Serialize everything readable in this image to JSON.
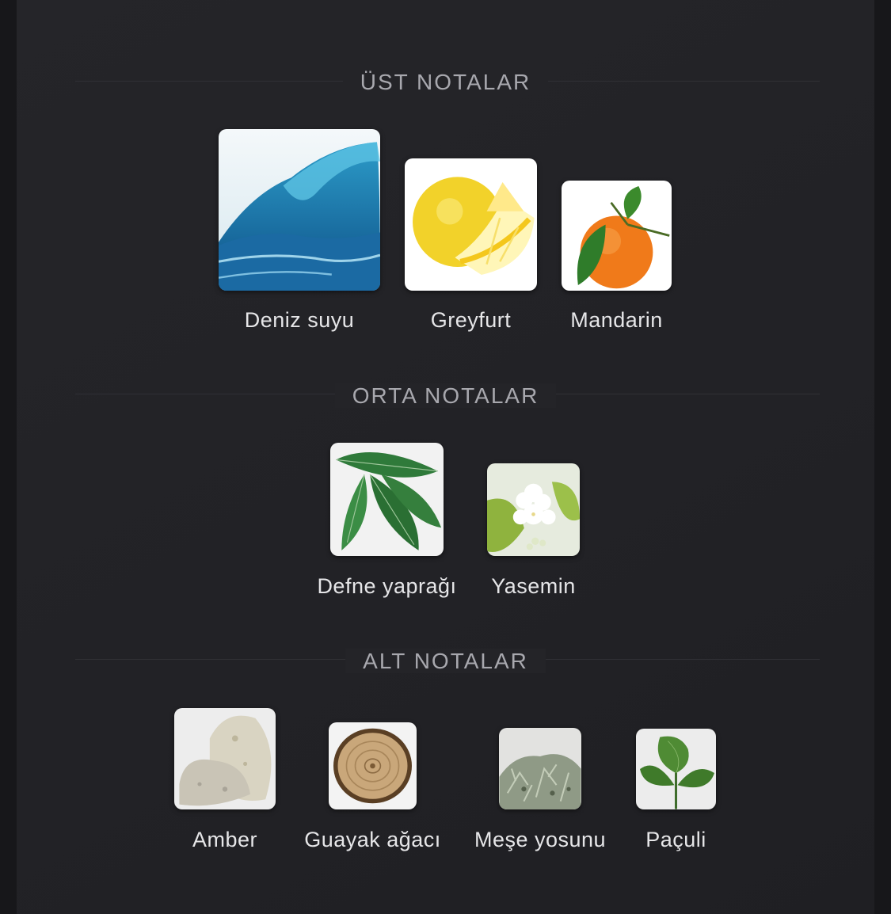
{
  "sections": [
    {
      "title": "ÜST NOTALAR",
      "notes": [
        {
          "label": "Deniz suyu",
          "icon": "sea-wave-icon"
        },
        {
          "label": "Greyfurt",
          "icon": "grapefruit-icon"
        },
        {
          "label": "Mandarin",
          "icon": "mandarin-icon"
        }
      ]
    },
    {
      "title": "ORTA NOTALAR",
      "notes": [
        {
          "label": "Defne yaprağı",
          "icon": "bay-leaf-icon"
        },
        {
          "label": "Yasemin",
          "icon": "jasmine-icon"
        }
      ]
    },
    {
      "title": "ALT NOTALAR",
      "notes": [
        {
          "label": "Amber",
          "icon": "amber-stone-icon"
        },
        {
          "label": "Guayak ağacı",
          "icon": "guaiac-wood-icon"
        },
        {
          "label": "Meşe yosunu",
          "icon": "oakmoss-icon"
        },
        {
          "label": "Paçuli",
          "icon": "patchouli-icon"
        }
      ]
    }
  ],
  "colors": {
    "background": "#242428",
    "title": "#a8a8ae",
    "label": "#e6e6e8"
  }
}
